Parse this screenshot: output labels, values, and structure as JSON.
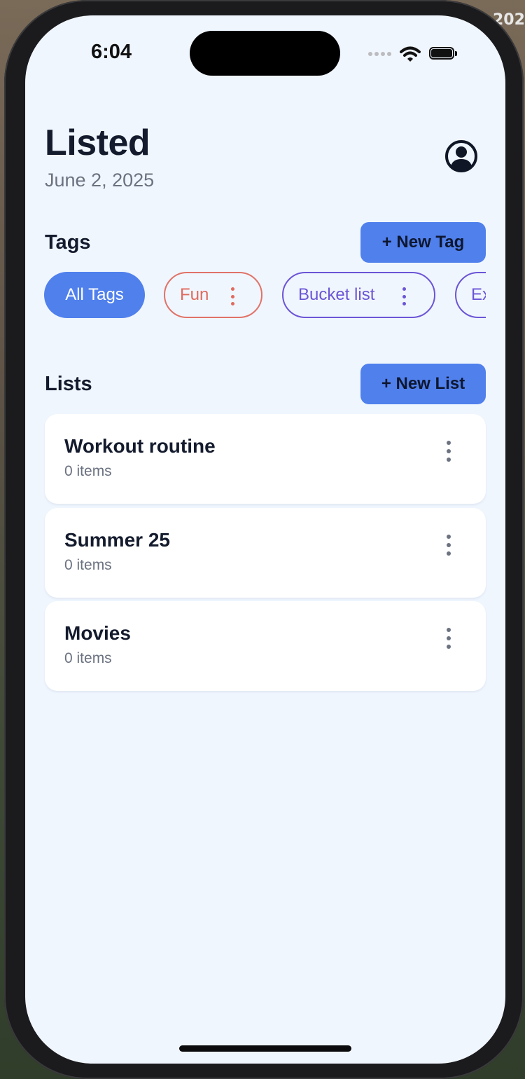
{
  "background": {
    "corner_text": "202"
  },
  "status_bar": {
    "time": "6:04",
    "wifi_icon": "wifi-icon",
    "battery_icon": "battery-icon",
    "signal_icon": "signal-icon"
  },
  "header": {
    "title": "Listed",
    "date": "June 2, 2025",
    "profile_icon": "user-circle-icon"
  },
  "tags": {
    "title": "Tags",
    "new_button": "+ New Tag",
    "items": [
      {
        "label": "All Tags",
        "selected": true,
        "color": "#5080ec"
      },
      {
        "label": "Fun",
        "selected": false,
        "color": "#e06a5f"
      },
      {
        "label": "Bucket list",
        "selected": false,
        "color": "#6b55d6"
      },
      {
        "label": "Ex",
        "selected": false,
        "color": "#6b55d6"
      }
    ]
  },
  "lists": {
    "title": "Lists",
    "new_button": "+ New List",
    "items": [
      {
        "name": "Workout routine",
        "count": "0 items"
      },
      {
        "name": "Summer 25",
        "count": "0 items"
      },
      {
        "name": "Movies",
        "count": "0 items"
      }
    ]
  },
  "colors": {
    "accent": "#5080ec",
    "screen_background": "#f0f6fe",
    "text_primary": "#141b2d",
    "text_secondary": "#6b7280"
  }
}
